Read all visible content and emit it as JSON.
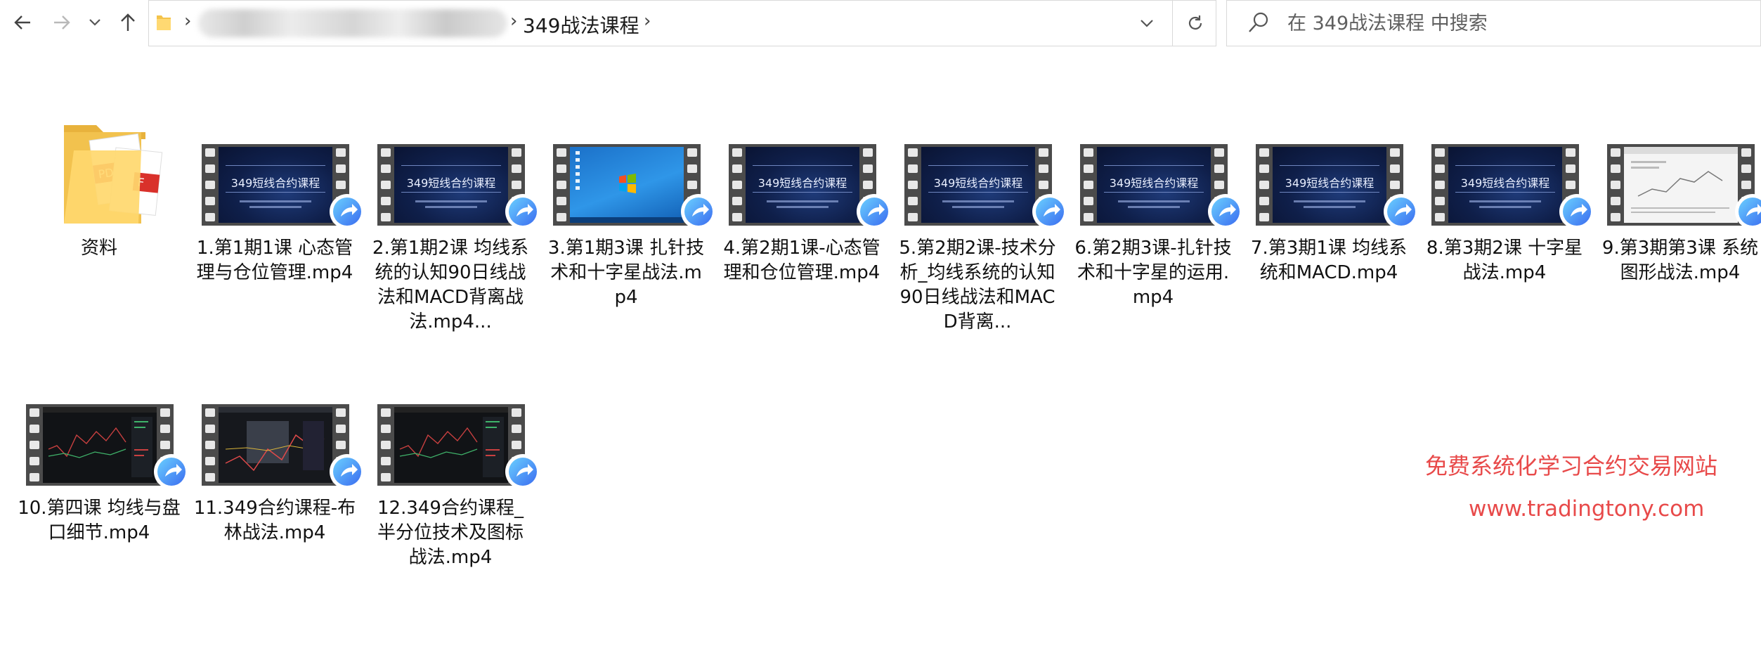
{
  "nav": {
    "back_icon": "arrow-left-icon",
    "forward_icon": "arrow-right-icon",
    "recent_icon": "chevron-down-icon",
    "up_icon": "arrow-up-icon"
  },
  "address_bar": {
    "current_folder": "349战法课程",
    "refresh_icon": "refresh-icon"
  },
  "search": {
    "placeholder": "在 349战法课程 中搜索"
  },
  "files": [
    {
      "name": "资料",
      "type": "folder"
    },
    {
      "name": "1.第1期1课 心态管理与仓位管理.mp4",
      "type": "video",
      "thumb": "slide"
    },
    {
      "name": "2.第1期2课 均线系统的认知90日线战法和MACD背离战法.mp4...",
      "type": "video",
      "thumb": "slide"
    },
    {
      "name": "3.第1期3课 扎针技术和十字星战法.mp4",
      "type": "video",
      "thumb": "win"
    },
    {
      "name": "4.第2期1课-心态管理和仓位管理.mp4",
      "type": "video",
      "thumb": "slide"
    },
    {
      "name": "5.第2期2课-技术分析_均线系统的认知90日线战法和MACD背离...",
      "type": "video",
      "thumb": "slide"
    },
    {
      "name": "6.第2期3课-扎针技术和十字星的运用.mp4",
      "type": "video",
      "thumb": "slide"
    },
    {
      "name": "7.第3期1课 均线系统和MACD.mp4",
      "type": "video",
      "thumb": "slide"
    },
    {
      "name": "8.第3期2课 十字星战法.mp4",
      "type": "video",
      "thumb": "slide"
    },
    {
      "name": "9.第3期第3课 系统图形战法.mp4",
      "type": "video",
      "thumb": "web"
    },
    {
      "name": "10.第四课 均线与盘口细节.mp4",
      "type": "video",
      "thumb": "dark"
    },
    {
      "name": "11.349合约课程-布林战法.mp4",
      "type": "video",
      "thumb": "dashboard"
    },
    {
      "name": "12.349合约课程_半分位技术及图标战法.mp4",
      "type": "video",
      "thumb": "dark"
    }
  ],
  "slide_title": "349短线合约课程",
  "watermark": {
    "line1": "免费系统化学习合约交易网站",
    "line2": "www.tradingtony.com"
  }
}
